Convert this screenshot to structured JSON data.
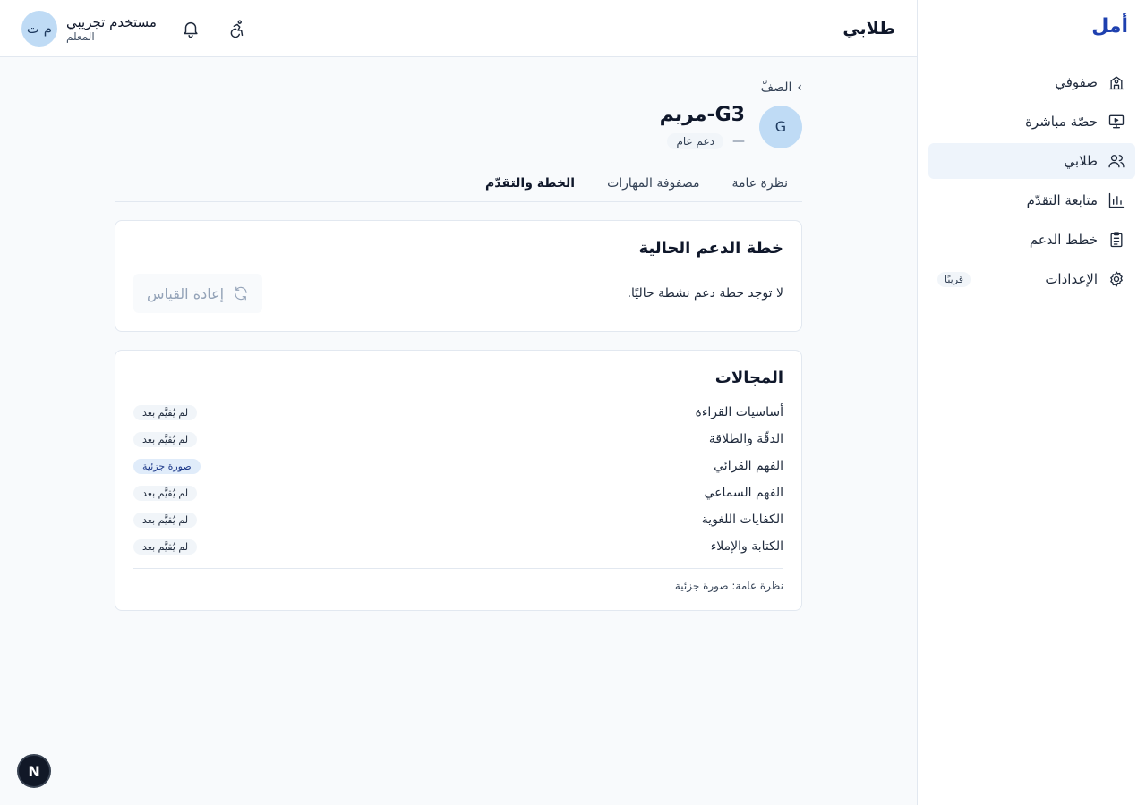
{
  "app": {
    "brand": "أمل"
  },
  "sidebar": {
    "items": [
      {
        "label": "صفوفي",
        "icon": "school-icon"
      },
      {
        "label": "حصّة مباشرة",
        "icon": "presentation-icon"
      },
      {
        "label": "طلابي",
        "icon": "users-icon",
        "active": true
      },
      {
        "label": "متابعة التقدّم",
        "icon": "bar-chart-icon"
      },
      {
        "label": "خطط الدعم",
        "icon": "clipboard-icon"
      },
      {
        "label": "الإعدادات",
        "icon": "gear-icon",
        "badge": "قريبًا"
      }
    ]
  },
  "header": {
    "title": "طلابي",
    "user": {
      "initials": "م ت",
      "name": "مستخدم تجريبي",
      "role": "المعلم"
    }
  },
  "student": {
    "breadcrumb": "الصفّ",
    "avatar_letter": "G",
    "name": "G3-مريم",
    "dash": "—",
    "support_level": "دعم عام"
  },
  "tabs": [
    {
      "label": "نظرة عامة"
    },
    {
      "label": "مصفوفة المهارات"
    },
    {
      "label": "الخطة والتقدّم",
      "active": true
    }
  ],
  "plan_card": {
    "title": "خطة الدعم الحالية",
    "empty_text": "لا توجد خطة دعم نشطة حاليًا.",
    "remeasure_label": "إعادة القياس"
  },
  "domains_card": {
    "title": "المجالات",
    "domains": [
      {
        "name": "أساسيات القراءة",
        "status": "لم يُقيَّم بعد",
        "partial": false
      },
      {
        "name": "الدقّة والطلاقة",
        "status": "لم يُقيَّم بعد",
        "partial": false
      },
      {
        "name": "الفهم القرائي",
        "status": "صورة جزئية",
        "partial": true
      },
      {
        "name": "الفهم السماعي",
        "status": "لم يُقيَّم بعد",
        "partial": false
      },
      {
        "name": "الكفايات اللغوية",
        "status": "لم يُقيَّم بعد",
        "partial": false
      },
      {
        "name": "الكتابة والإملاء",
        "status": "لم يُقيَّم بعد",
        "partial": false
      }
    ],
    "overview": "نظرة عامة: صورة جزئية"
  },
  "fab": {
    "letter": "N"
  },
  "colors": {
    "brand": "#1e40af",
    "active_nav_bg": "#eef4fb",
    "avatar_bg": "#bfdbf5",
    "partial_badge_bg": "#e0ecfa"
  }
}
